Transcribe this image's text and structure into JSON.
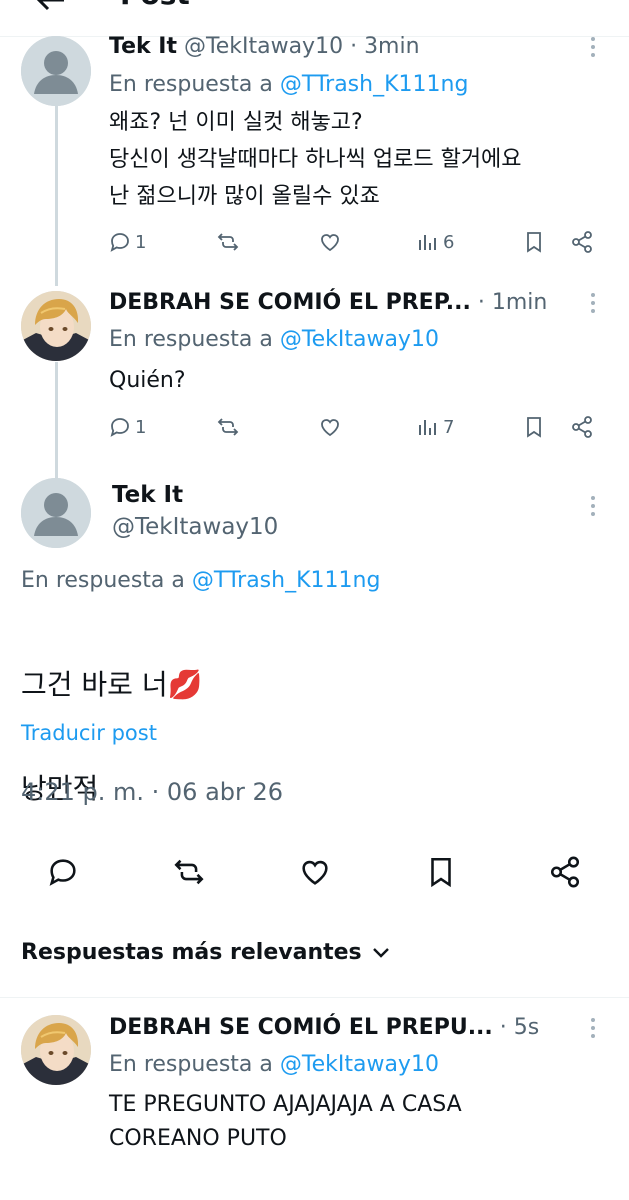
{
  "topbar": {
    "title": "Post"
  },
  "thread": [
    {
      "display_name": "Tek It",
      "handle": "@TekItaway10",
      "time": "3min",
      "reply_prefix": "En respuesta a",
      "reply_to": "@TTrash_K111ng",
      "text": "왜죠? 넌 이미 실컷 해놓고?\n당신이 생각날때마다 하나씩 업로드 할거에요\n난 젊으니까 많이 올릴수 있죠",
      "replies": "1",
      "views": "6"
    },
    {
      "display_name": "DEBRAH SE COMIÓ EL PREP...",
      "time": "1min",
      "reply_prefix": "En respuesta a",
      "reply_to": "@TekItaway10",
      "text": "Quién?",
      "replies": "1",
      "views": "7"
    }
  ],
  "main_post": {
    "display_name": "Tek It",
    "handle": "@TekItaway10",
    "reply_prefix": "En respuesta a",
    "reply_to": "@TTrash_K111ng",
    "line1": "그건 바로 너💋",
    "line2": "낭만적",
    "translate_label": "Traducir post",
    "timestamp": "4:21 p. m. · 06 abr 26"
  },
  "sort": {
    "label": "Respuestas más relevantes"
  },
  "reply": {
    "display_name": "DEBRAH SE COMIÓ EL PREPU...",
    "time": "5s",
    "reply_prefix": "En respuesta a",
    "reply_to": "@TekItaway10",
    "text": "TE PREGUNTO AJAJAJAJA A CASA\nCOREANO PUTO"
  },
  "icons": [
    "back-arrow-icon",
    "reply-icon",
    "repost-icon",
    "like-icon",
    "views-icon",
    "bookmark-icon",
    "share-icon",
    "more-icon",
    "chevron-down-icon"
  ],
  "colors": {
    "accent": "#1d9bf0",
    "text": "#0f1419",
    "secondary": "#536471",
    "divider": "#eff3f4"
  }
}
